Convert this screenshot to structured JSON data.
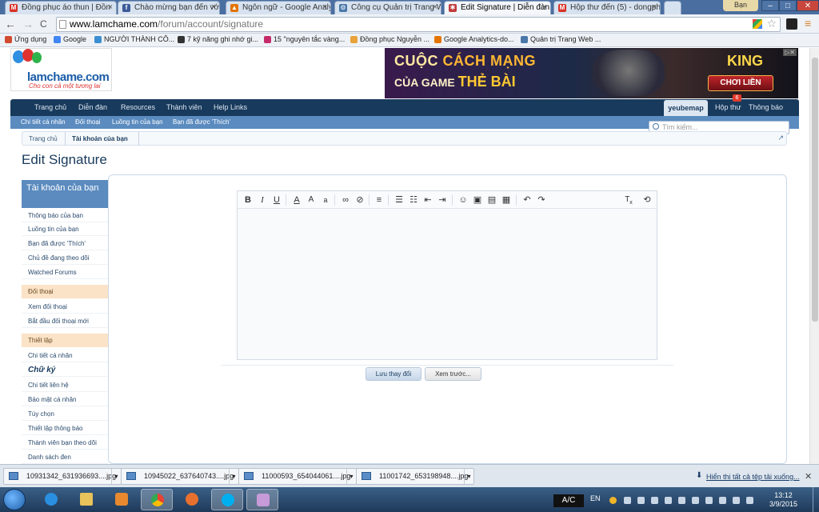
{
  "tabs": [
    {
      "title": "Đồng phục áo thun | Đồn",
      "icon": "gmail-icon",
      "color": "#d93025"
    },
    {
      "title": "Chào mừng bạn đến với",
      "icon": "facebook-icon",
      "color": "#3b5998"
    },
    {
      "title": "Ngôn ngữ - Google Analy",
      "icon": "analytics-icon",
      "color": "#e37400"
    },
    {
      "title": "Công cụ Quản trị Trang W",
      "icon": "webmaster-icon",
      "color": "#4a78a8"
    },
    {
      "title": "Edit Signature | Diễn đàn L",
      "icon": "site-icon",
      "color": "#c03b3b",
      "active": true
    },
    {
      "title": "Hộp thư đến (5) - dongph",
      "icon": "gmail-icon",
      "color": "#d93025"
    }
  ],
  "window": {
    "user": "Bạn",
    "minimize": "–",
    "maximize": "□",
    "close": "✕"
  },
  "toolbar": {
    "back": "←",
    "forward": "→",
    "reload": "C",
    "url_domain": "www.lamchame.com",
    "url_path": "/forum/account/signature"
  },
  "bookmarks": [
    {
      "label": "Ứng dụng",
      "color": "#d04b2f"
    },
    {
      "label": "Google",
      "color": "#4285f4"
    },
    {
      "label": "NGƯỜI THÀNH CÔ...",
      "color": "#3b8ed1"
    },
    {
      "label": "7 kỹ năng ghi nhớ gi...",
      "color": "#333"
    },
    {
      "label": "15 \"nguyên tắc vàng...",
      "color": "#c52b6a"
    },
    {
      "label": "Đồng phục Nguyễn ...",
      "color": "#e8a23a"
    },
    {
      "label": "Google Analytics-do...",
      "color": "#e37400"
    },
    {
      "label": "Quản trị Trang Web ...",
      "color": "#4a78a8"
    }
  ],
  "logo": {
    "name": "lamchame.com",
    "tagline": "Cho con cả một tương lai"
  },
  "ad": {
    "line1a": "CUỘC ",
    "line1b": "CÁCH MẠNG",
    "line2a": "CỦA GAME ",
    "line2b": "THẺ BÀI",
    "brand": "KING",
    "cta": "CHƠI LIỀN"
  },
  "nav": {
    "items": [
      "Trang chủ",
      "Diễn đàn",
      "Resources",
      "Thành viên",
      "Help Links"
    ],
    "user": "yeubemap",
    "inbox": "Hộp thư",
    "inbox_count": "6",
    "alerts": "Thông báo"
  },
  "subnav": [
    "Chi tiết cá nhân",
    "Đối thoại",
    "Luồng tin của bạn",
    "Bạn đã được 'Thích'"
  ],
  "search": {
    "placeholder": "Tìm kiếm..."
  },
  "breadcrumb": {
    "home": "Trang chủ",
    "current": "Tài khoản của bạn"
  },
  "page_title": "Edit Signature",
  "sidebar": {
    "header": "Tài khoản của bạn",
    "groups": [
      {
        "items": [
          "Thông báo của bạn",
          "Luồng tin của bạn",
          "Bạn đã được 'Thích'",
          "Chủ đề đang theo dõi",
          "Watched Forums"
        ]
      },
      {
        "title": "Đối thoại",
        "items": [
          "Xem đối thoại",
          "Bắt đầu đối thoại mới"
        ]
      },
      {
        "title": "Thiết lập",
        "items": [
          "Chi tiết cá nhân",
          "Chữ ký",
          "Chi tiết liên hệ",
          "Bảo mật cá nhân",
          "Tùy chọn",
          "Thiết lập thông báo",
          "Thành viên bạn theo dõi",
          "Danh sách đen"
        ]
      }
    ]
  },
  "editor": {
    "toolbar": [
      "B",
      "I",
      "U",
      "A",
      "A",
      "a",
      "link",
      "unlink",
      "align",
      "ul",
      "ol",
      "outdent",
      "indent",
      "smiley",
      "image",
      "media",
      "code",
      "undo",
      "redo",
      "Tx",
      "switch"
    ]
  },
  "buttons": {
    "save": "Lưu thay đổi",
    "preview": "Xem trước..."
  },
  "downloads": {
    "items": [
      "10931342_631936693....jpg",
      "10945022_637640743....jpg",
      "11000593_654044061....jpg",
      "11001742_653198948....jpg"
    ],
    "show_all": "Hiển thị tất cả tệp tải xuống...",
    "close": "✕"
  },
  "taskbar": {
    "lang_box": "A/C",
    "lang": "EN",
    "time": "13:12",
    "date": "3/9/2015"
  }
}
